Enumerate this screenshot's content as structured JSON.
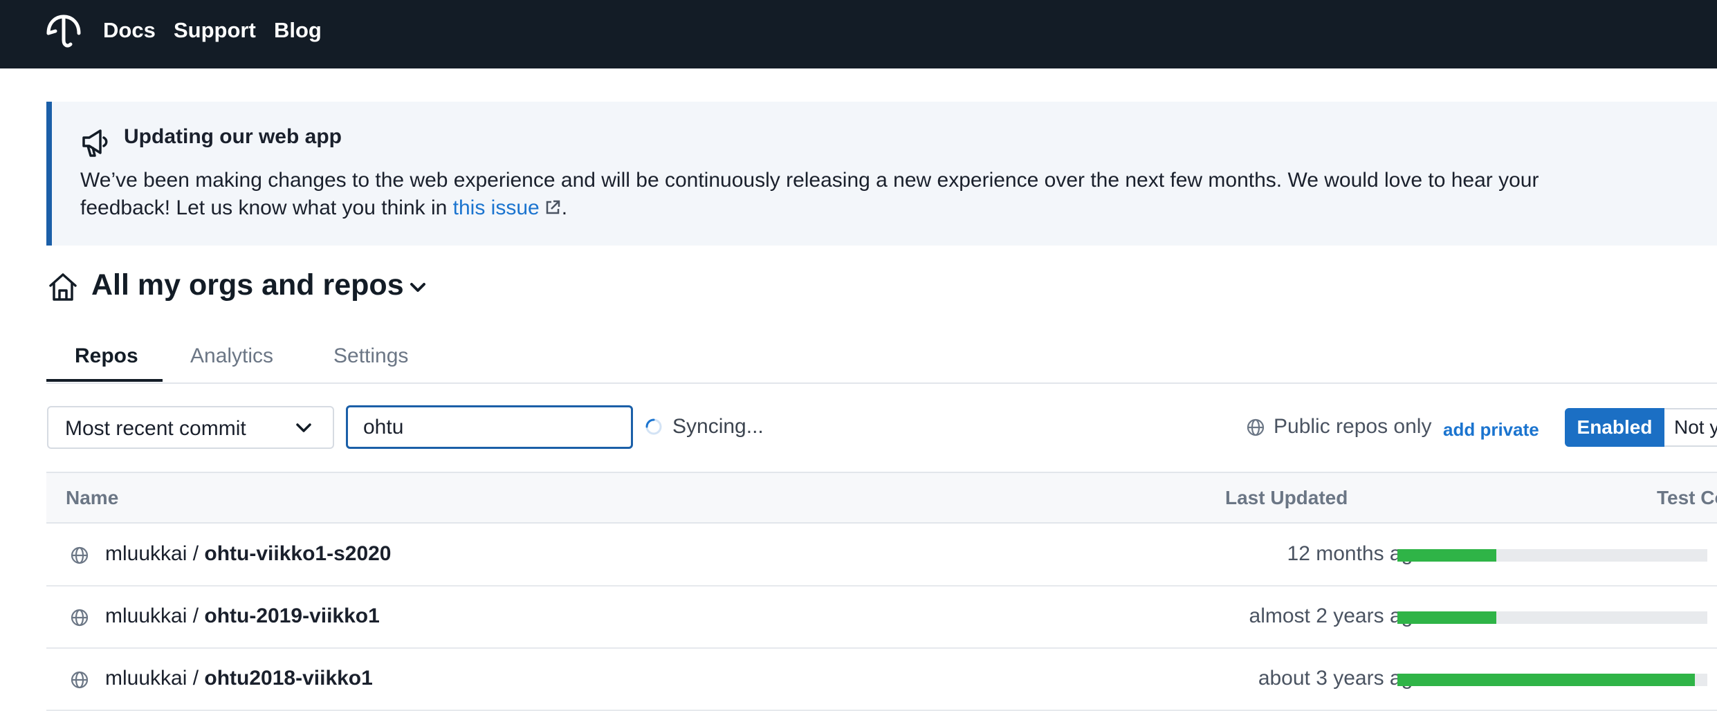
{
  "nav": {
    "logo_icon": "codecov-umbrella-icon",
    "links": [
      "Docs",
      "Support",
      "Blog"
    ]
  },
  "banner": {
    "icon": "megaphone-icon",
    "title": "Updating our web app",
    "text_before": "We’ve been making changes to the web experience and will be continuously releasing a new experience over the next few months. We would love to hear your feedback! Let us know what you think in ",
    "link_text": "this issue",
    "text_after": "."
  },
  "page": {
    "title": "All my orgs and repos"
  },
  "tabs": [
    "Repos",
    "Analytics",
    "Settings"
  ],
  "filters": {
    "sort_value": "Most recent commit",
    "search_value": "ohtu",
    "sync_text": "Syncing...",
    "public_text": "Public repos only",
    "add_private": "add private",
    "toggle_enabled": "Enabled",
    "toggle_not": "Not yet setup"
  },
  "table": {
    "columns": [
      "Name",
      "Last Updated",
      "Test Coverage"
    ],
    "rows": [
      {
        "owner": "mluukkai",
        "sep": " / ",
        "repo": "ohtu-viikko1-s2020",
        "updated": "12 months ago",
        "coverage": 0.32
      },
      {
        "owner": "mluukkai",
        "sep": " / ",
        "repo": "ohtu-2019-viikko1",
        "updated": "almost 2 years ago",
        "coverage": 0.32
      },
      {
        "owner": "mluukkai",
        "sep": " / ",
        "repo": "ohtu2018-viikko1",
        "updated": "about 3 years ago",
        "coverage": 0.96
      }
    ]
  },
  "colors": {
    "nav_bg": "#131c26",
    "accent": "#1b6fc4",
    "coverage_good": "#2fb447"
  }
}
